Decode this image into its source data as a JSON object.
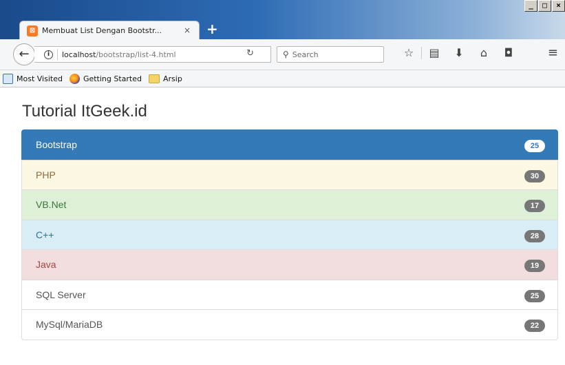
{
  "browser": {
    "window_controls": [
      "_",
      "□",
      "×"
    ],
    "tab": {
      "title": "Membuat List Dengan Bootstr...",
      "close_icon": "×",
      "favicon": "xampp-icon"
    },
    "newtab_label": "+",
    "url": {
      "host": "localhost",
      "path": "/bootstrap/list-4.html"
    },
    "search_placeholder": "Search",
    "bookmarks": [
      "Most Visited",
      "Getting Started",
      "Arsip"
    ]
  },
  "page": {
    "title": "Tutorial ItGeek.id",
    "list_items": [
      {
        "label": "Bootstrap",
        "badge": "25",
        "variant": "active"
      },
      {
        "label": "PHP",
        "badge": "30",
        "variant": "warning"
      },
      {
        "label": "VB.Net",
        "badge": "17",
        "variant": "success"
      },
      {
        "label": "C++",
        "badge": "28",
        "variant": "info"
      },
      {
        "label": "Java",
        "badge": "19",
        "variant": "danger"
      },
      {
        "label": "SQL Server",
        "badge": "25",
        "variant": "default"
      },
      {
        "label": "MySql/MariaDB",
        "badge": "22",
        "variant": "default"
      }
    ]
  },
  "colors": {
    "active_bg": "#337ab7",
    "active_text": "#ffffff",
    "warning_bg": "#fcf8e3",
    "warning_text": "#8a6d3b",
    "success_bg": "#dff0d8",
    "success_text": "#3c763d",
    "info_bg": "#d9edf7",
    "info_text": "#31708f",
    "danger_bg": "#f2dede",
    "danger_text": "#a94442",
    "default_bg": "#ffffff",
    "default_text": "#555555",
    "badge_bg": "#777777"
  }
}
